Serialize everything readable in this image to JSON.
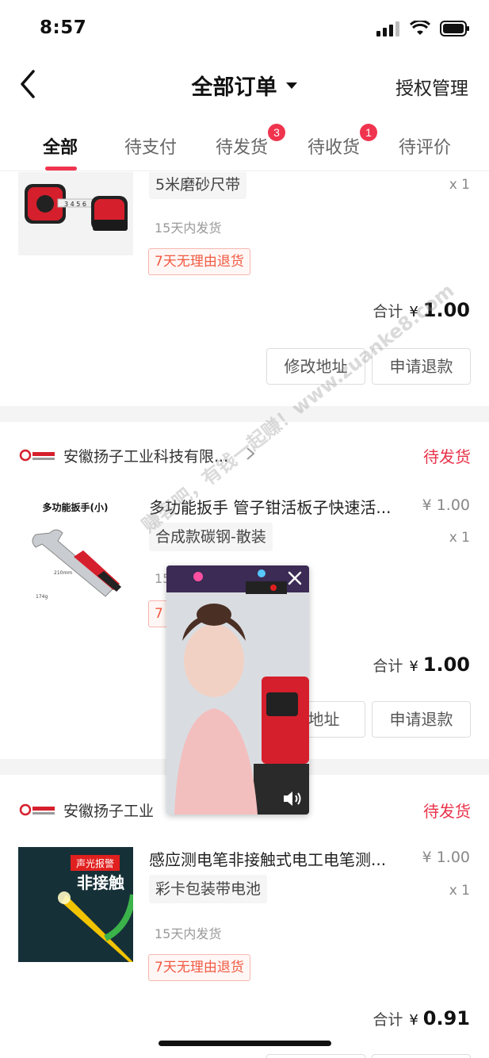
{
  "status_bar": {
    "time": "8:57"
  },
  "nav": {
    "title": "全部订单",
    "right_action": "授权管理"
  },
  "tabs": [
    {
      "label": "全部",
      "active": true,
      "badge": ""
    },
    {
      "label": "待支付",
      "active": false,
      "badge": ""
    },
    {
      "label": "待发货",
      "active": false,
      "badge": "3"
    },
    {
      "label": "待收货",
      "active": false,
      "badge": "1"
    },
    {
      "label": "待评价",
      "active": false,
      "badge": ""
    }
  ],
  "orders": [
    {
      "product_title": "5米磨砂尺带",
      "price": "",
      "sku": "5米磨砂尺带",
      "qty": "x 1",
      "shipping": "15天内发货",
      "return_policy": "7天无理由退货",
      "total_label": "合计",
      "total_currency": "¥",
      "total_value": "1.00",
      "actions": [
        "修改地址",
        "申请退款"
      ]
    },
    {
      "store_name": "安徽扬子工业科技有限...",
      "status": "待发货",
      "product_title": "多功能扳手 管子钳活板子快速活...",
      "price": "¥ 1.00",
      "sku": "合成款碳钢-散装",
      "qty": "x 1",
      "shipping": "15",
      "return_policy": "7",
      "total_label": "合计",
      "total_currency": "¥",
      "total_value": "1.00",
      "actions": [
        "改地址",
        "申请退款"
      ],
      "thumb_caption": "多功能扳手(小)"
    },
    {
      "store_name": "安徽扬子工业",
      "status": "待发货",
      "product_title": "感应测电笔非接触式电工电笔测...",
      "price": "¥ 1.00",
      "sku": "彩卡包装带电池",
      "qty": "x 1",
      "shipping": "15天内发货",
      "return_policy": "7天无理由退货",
      "total_label": "合计",
      "total_currency": "¥",
      "total_value": "0.91",
      "thumb_caption_top": "声光报警",
      "thumb_caption_main": "非接触"
    }
  ],
  "watermark": "赚客吧，有钱一起赚！www.zuanke8.com",
  "colors": {
    "accent": "#f0344e",
    "status_red": "#e8334a",
    "return_orange": "#f15a43"
  },
  "icons": [
    "back-icon",
    "dropdown-icon",
    "signal-icon",
    "wifi-icon",
    "battery-icon",
    "chevron-right-icon",
    "close-icon",
    "mute-icon"
  ]
}
